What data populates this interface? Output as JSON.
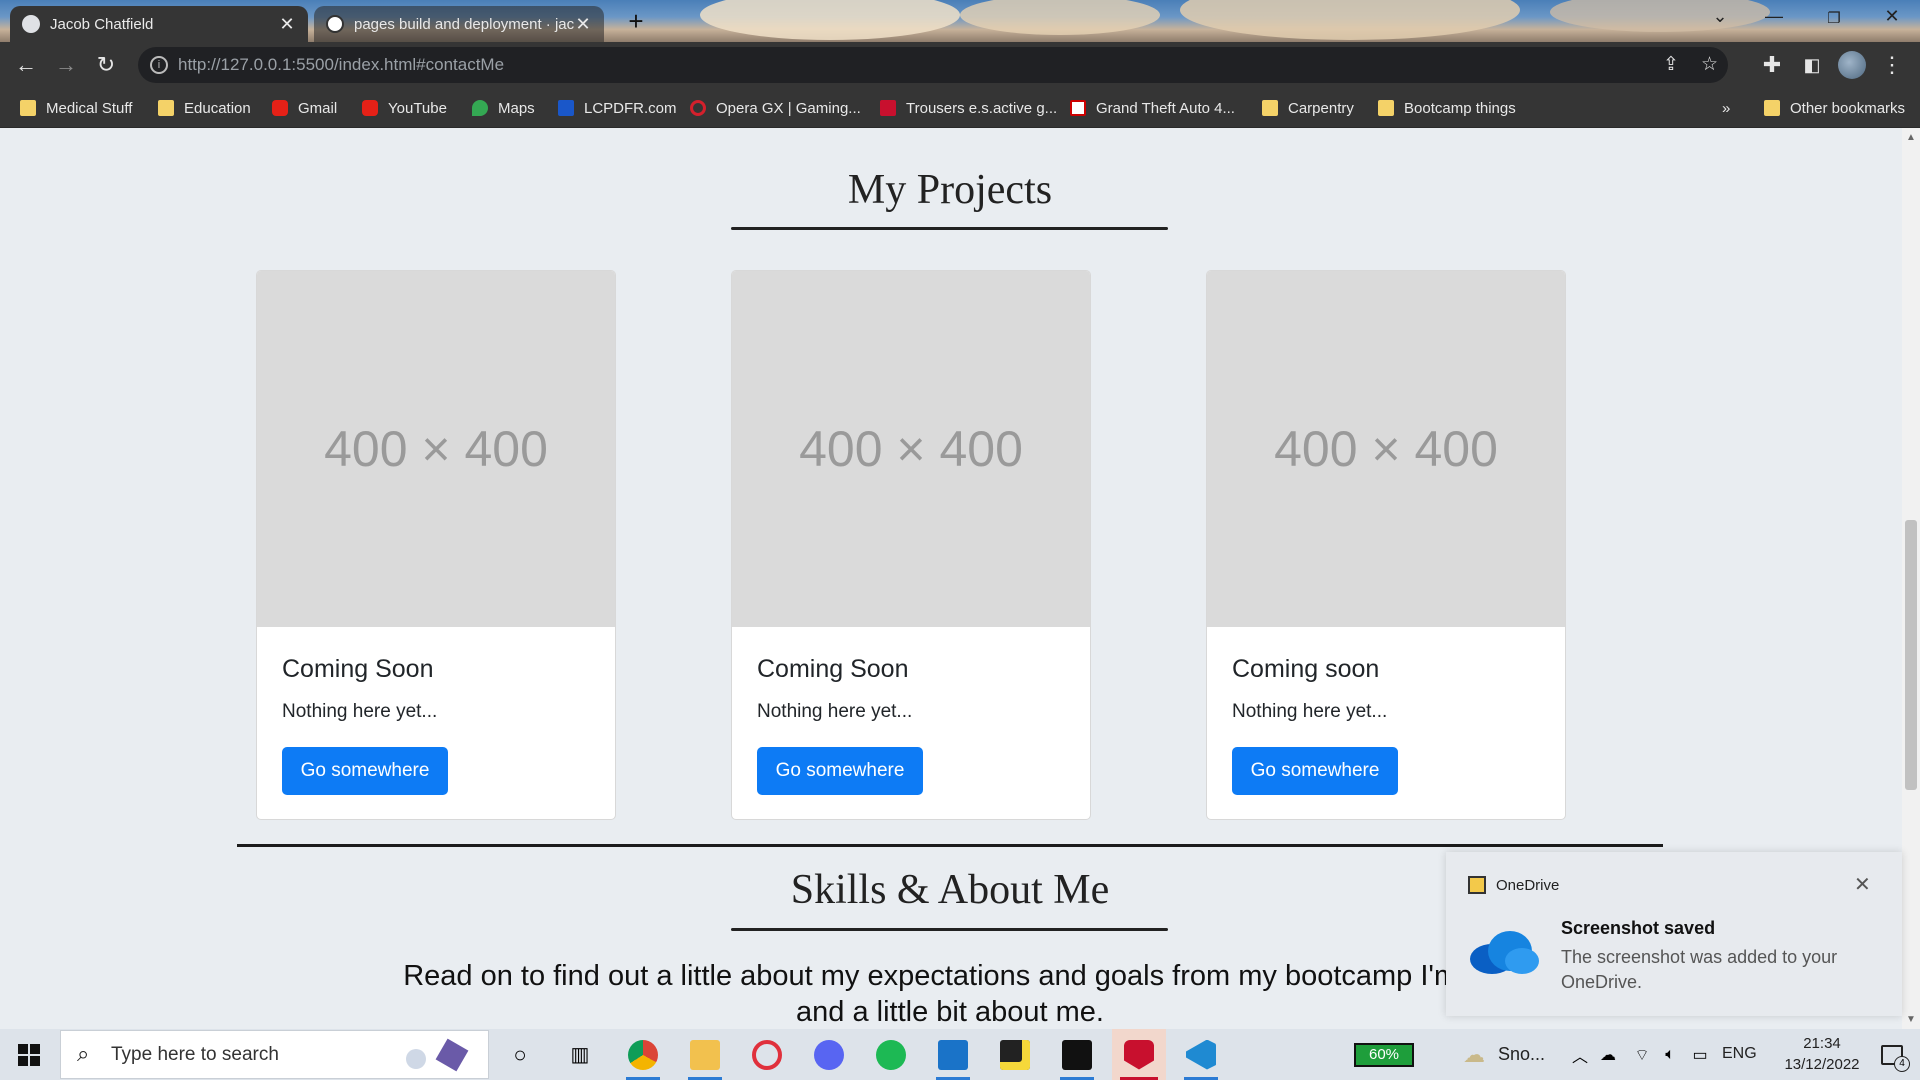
{
  "browser": {
    "tabs": [
      {
        "title": "Jacob Chatfield",
        "active": true
      },
      {
        "title": "pages build and deployment · jac",
        "active": false
      }
    ],
    "new_tab_icon": "plus-icon",
    "url_host": "http://127.0.0.1",
    "url_rest": ":5500/index.html#contactMe",
    "bookmarks": [
      {
        "label": "Medical Stuff",
        "icon": "folder-icon"
      },
      {
        "label": "Education",
        "icon": "folder-icon"
      },
      {
        "label": "Gmail",
        "icon": "youtube-icon"
      },
      {
        "label": "YouTube",
        "icon": "youtube-icon"
      },
      {
        "label": "Maps",
        "icon": "maps-icon"
      },
      {
        "label": "LCPDFR.com",
        "icon": "lcpdfr-icon"
      },
      {
        "label": "Opera GX | Gaming...",
        "icon": "opera-icon"
      },
      {
        "label": "Trousers e.s.active g...",
        "icon": "g-icon"
      },
      {
        "label": "Grand Theft Auto 4...",
        "icon": "gtanet-icon"
      },
      {
        "label": "Carpentry",
        "icon": "folder-icon"
      },
      {
        "label": "Bootcamp things",
        "icon": "folder-icon"
      }
    ],
    "overflow_label": "»",
    "other_bookmarks": "Other bookmarks"
  },
  "page": {
    "projects_title": "My Projects",
    "cards": [
      {
        "placeholder": "400 × 400",
        "title": "Coming Soon",
        "text": "Nothing here yet...",
        "button": "Go somewhere"
      },
      {
        "placeholder": "400 × 400",
        "title": "Coming Soon",
        "text": "Nothing here yet...",
        "button": "Go somewhere"
      },
      {
        "placeholder": "400 × 400",
        "title": "Coming soon",
        "text": "Nothing here yet...",
        "button": "Go somewhere"
      }
    ],
    "skills_title": "Skills & About Me",
    "intro_line1": "Read on to find out a little about my expectations and goals from my bootcamp I'm cu",
    "intro_line2": "and a little bit about me."
  },
  "toast": {
    "app": "OneDrive",
    "heading": "Screenshot saved",
    "body": "The screenshot was added to your OneDrive."
  },
  "taskbar": {
    "search_placeholder": "Type here to search",
    "battery_label": "60%",
    "weather_label": "Sno...",
    "language": "ENG",
    "time": "21:34",
    "date": "13/12/2022",
    "notification_count": "4"
  },
  "colors": {
    "accent_button": "#0d7bf5",
    "page_bg": "#e9edf1",
    "chrome_bg": "#353535"
  }
}
